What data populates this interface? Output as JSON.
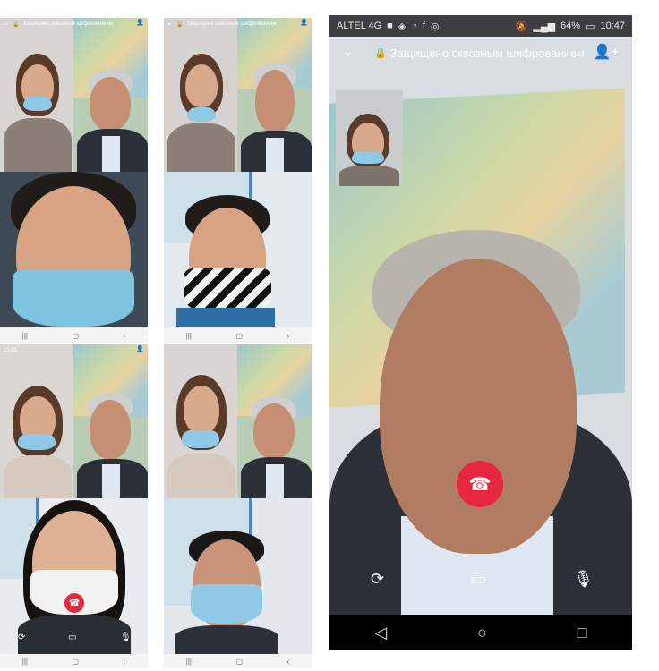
{
  "collage": {
    "small_panels": [
      {
        "status_time": "",
        "encryption_text": "Защищено сквозным шифрованием"
      },
      {
        "status_time": "",
        "encryption_text": "Защищено сквозным шифрованием"
      },
      {
        "status_time": "10:55",
        "encryption_text": ""
      },
      {
        "status_time": "",
        "encryption_text": ""
      }
    ],
    "main_panel": {
      "carrier": "ALTEL 4G",
      "battery": "64%",
      "time": "10:47",
      "encryption_text": "Защищено сквозным шифрованием"
    }
  },
  "icons": {
    "chevron": "chevron-down-icon",
    "lock": "lock-icon",
    "add_user": "add-user-icon",
    "end_call": "end-call-icon",
    "camera_switch": "camera-switch-icon",
    "video_off": "video-off-icon",
    "mic_off": "mic-off-icon",
    "nav_back": "nav-back-icon",
    "nav_home": "nav-home-icon",
    "nav_recent": "nav-recent-icon"
  },
  "colors": {
    "end_call": "#e8263f",
    "status_bar": "#3b3f40",
    "nav_bar": "#000000"
  }
}
